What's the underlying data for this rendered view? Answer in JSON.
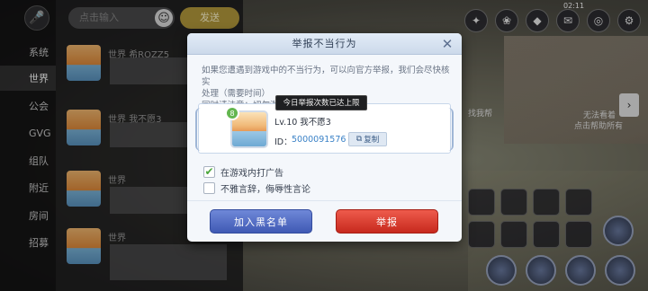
{
  "chat": {
    "channels": [
      "系统",
      "世界",
      "公会",
      "GVG",
      "组队",
      "附近",
      "房间",
      "招募"
    ],
    "active_channel": "世界",
    "search_placeholder": "点击输入",
    "send_label": "发送",
    "messages": [
      {
        "channel": "世界",
        "name": "希ROZZ5"
      },
      {
        "channel": "世界",
        "name": "我不愿3"
      },
      {
        "channel": "世界",
        "name": ""
      },
      {
        "channel": "世界",
        "name": ""
      }
    ]
  },
  "hud": {
    "time": "02:11",
    "npc_text_1": "找我帮",
    "npc_text_2": "无法看着",
    "npc_text_3": "点击帮助所有"
  },
  "dialog": {
    "title": "举报不当行为",
    "notice_line1": "如果您遭遇到游戏中的不当行为，可以向官方举报，我们会尽快核实",
    "notice_line2": "处理（需要时间）",
    "notice_line3": "同时请注意：切勿滥用此功能",
    "target": {
      "level_badge": "8",
      "name": "Lv.10 我不愿3",
      "id_label": "ID：",
      "id_value": "5000091576",
      "copy_label": "复制"
    },
    "tooltip": "今日举报次数已达上限",
    "options": [
      {
        "label": "在游戏内打广告",
        "checked": true
      },
      {
        "label": "不雅言辞，侮辱性言论",
        "checked": false
      }
    ],
    "blacklist_label": "加入黑名单",
    "report_label": "举报",
    "colors": {
      "blacklist": "#3f59b4",
      "report": "#c7291d",
      "check": "#4aa63b"
    }
  }
}
